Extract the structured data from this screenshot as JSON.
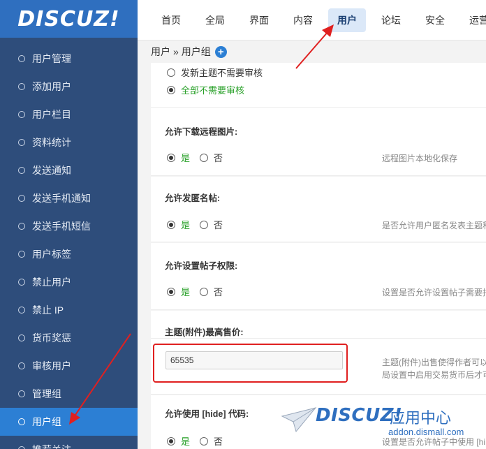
{
  "logo": "DISCUZ!",
  "sidebar": {
    "items": [
      {
        "label": "用户管理"
      },
      {
        "label": "添加用户"
      },
      {
        "label": "用户栏目"
      },
      {
        "label": "资料统计"
      },
      {
        "label": "发送通知"
      },
      {
        "label": "发送手机通知"
      },
      {
        "label": "发送手机短信"
      },
      {
        "label": "用户标签"
      },
      {
        "label": "禁止用户"
      },
      {
        "label": "禁止 IP"
      },
      {
        "label": "货币奖惩"
      },
      {
        "label": "审核用户"
      },
      {
        "label": "管理组"
      },
      {
        "label": "用户组"
      },
      {
        "label": "推荐关注"
      }
    ],
    "active_index": 13
  },
  "topnav": {
    "items": [
      "首页",
      "全局",
      "界面",
      "内容",
      "用户",
      "论坛",
      "安全",
      "运营"
    ],
    "active": "用户"
  },
  "breadcrumb": {
    "part1": "用户",
    "separator": "»",
    "part2": "用户组"
  },
  "settings": {
    "moderation": {
      "opt1": "发新主题不需要审核",
      "opt2": "全部不需要审核"
    },
    "remote_images": {
      "title": "允许下载远程图片:",
      "yes": "是",
      "no": "否",
      "hint": "远程图片本地化保存"
    },
    "anonymous": {
      "title": "允许发匿名帖:",
      "yes": "是",
      "no": "否",
      "hint": "是否允许用户匿名发表主题和"
    },
    "post_permission": {
      "title": "允许设置帖子权限:",
      "yes": "是",
      "no": "否",
      "hint": "设置是否允许设置帖子需要指"
    },
    "max_price": {
      "title": "主题(附件)最高售价:",
      "value": "65535",
      "hint1": "主题(附件)出售使得作者可以",
      "hint2": "局设置中启用交易货币后才可"
    },
    "hide_code": {
      "title": "允许使用 [hide] 代码:",
      "yes": "是",
      "no": "否",
      "hint": "设置是否允许帖子中使用 [hi"
    }
  },
  "watermark": {
    "brand": "DISCUZ!",
    "subtitle": "应用中心",
    "url": "addon.dismall.com"
  },
  "colors": {
    "sidebar_bg": "#2e4d7b",
    "logo_bg": "#2f6fbf",
    "active_bg": "#2c7fd4",
    "highlight": "#e02020",
    "green_text": "#2aa12a"
  }
}
